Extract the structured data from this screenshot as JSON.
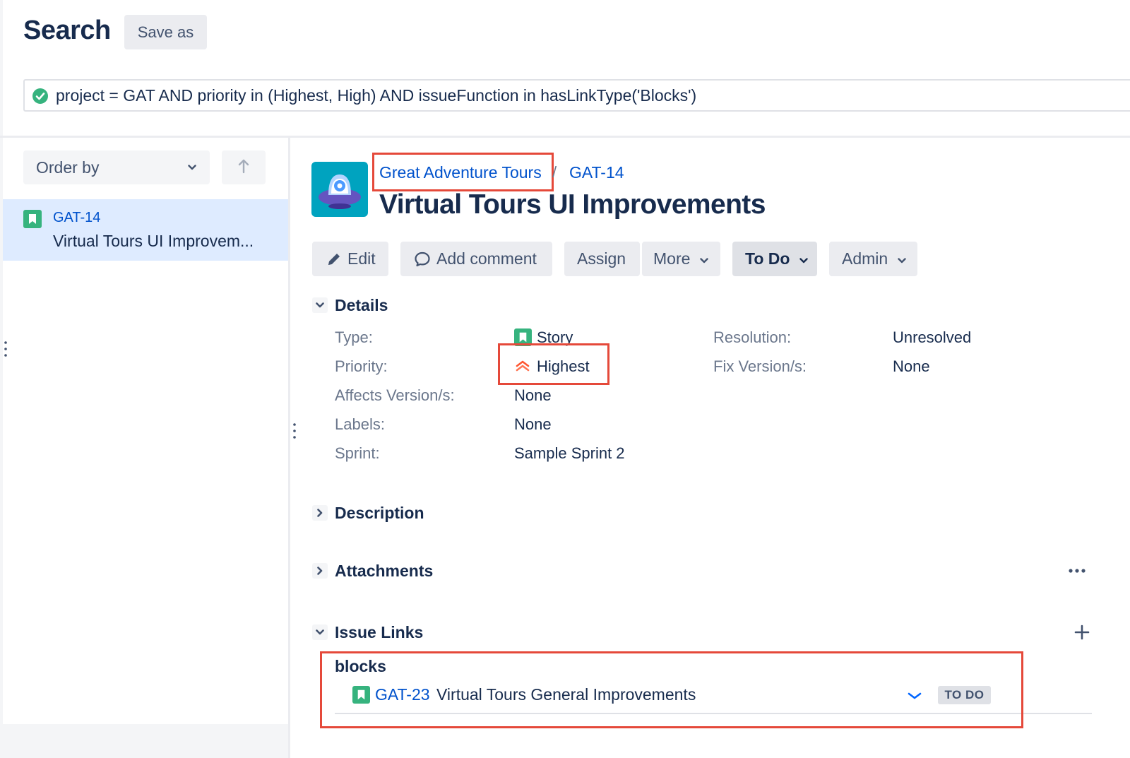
{
  "header": {
    "title": "Search",
    "save_as_label": "Save as"
  },
  "jql": {
    "query": "project = GAT AND priority in (Highest, High) AND issueFunction in hasLinkType('Blocks')",
    "status_icon": "check-circle-icon"
  },
  "left_panel": {
    "order_by_label": "Order by",
    "sort_icon": "arrow-up-icon",
    "items": [
      {
        "key": "GAT-14",
        "summary": "Virtual Tours UI Improvem...",
        "type_icon": "story-icon"
      }
    ]
  },
  "issue": {
    "project_name": "Great Adventure Tours",
    "breadcrumb_separator": "/",
    "key": "GAT-14",
    "title": "Virtual Tours UI Improvements"
  },
  "toolbar": {
    "edit_label": "Edit",
    "add_comment_label": "Add comment",
    "assign_label": "Assign",
    "more_label": "More",
    "status_label": "To Do",
    "admin_label": "Admin"
  },
  "details": {
    "section_title": "Details",
    "fields_left": [
      {
        "label": "Type:",
        "value": "Story"
      },
      {
        "label": "Priority:",
        "value": "Highest"
      },
      {
        "label": "Affects Version/s:",
        "value": "None"
      },
      {
        "label": "Labels:",
        "value": "None"
      },
      {
        "label": "Sprint:",
        "value": "Sample Sprint 2"
      }
    ],
    "fields_right": [
      {
        "label": "Resolution:",
        "value": "Unresolved"
      },
      {
        "label": "Fix Version/s:",
        "value": "None"
      }
    ]
  },
  "sections": {
    "description_title": "Description",
    "attachments_title": "Attachments",
    "issue_links_title": "Issue Links"
  },
  "issue_links": {
    "link_type": "blocks",
    "links": [
      {
        "key": "GAT-23",
        "summary": "Virtual Tours General Improvements",
        "status": "TO DO"
      }
    ]
  },
  "colors": {
    "link_blue": "#0052cc",
    "story_green": "#36b37e",
    "priority_highest": "#ff5630",
    "highlight_red": "#e5493a",
    "selected_row": "#deebff",
    "button_bg": "#ebecf0",
    "avatar_teal": "#00a3bf"
  }
}
